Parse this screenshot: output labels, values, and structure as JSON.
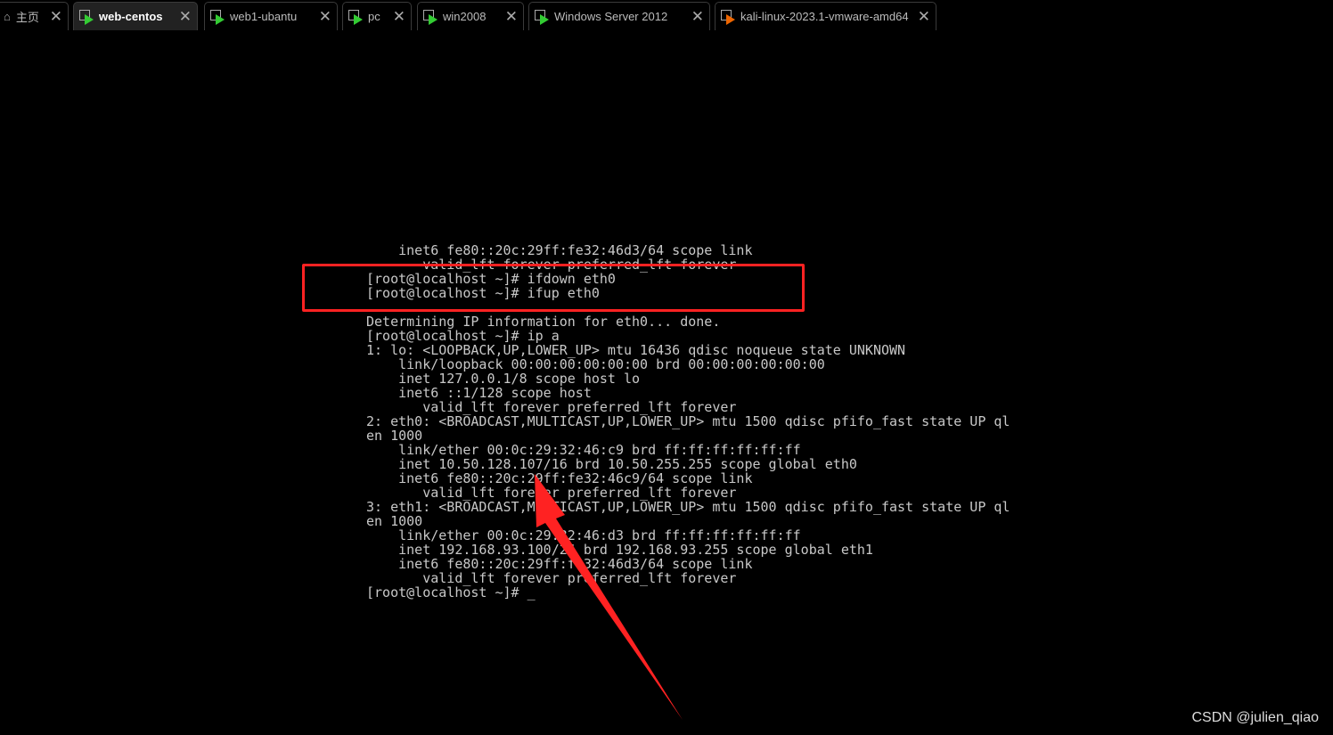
{
  "tabs": [
    {
      "label": "主页",
      "icon": "home-icon",
      "active": false
    },
    {
      "label": "web-centos",
      "icon": "vm-icon",
      "active": true
    },
    {
      "label": "web1-ubantu",
      "icon": "vm-icon",
      "active": false
    },
    {
      "label": "pc",
      "icon": "vm-icon",
      "active": false
    },
    {
      "label": "win2008",
      "icon": "vm-icon",
      "active": false
    },
    {
      "label": "Windows Server 2012",
      "icon": "vm-icon",
      "active": false
    },
    {
      "label": "kali-linux-2023.1-vmware-amd64",
      "icon": "vm-icon",
      "active": false
    }
  ],
  "terminal": {
    "lines": [
      "    inet6 fe80::20c:29ff:fe32:46d3/64 scope link",
      "       valid_lft forever preferred_lft forever",
      "[root@localhost ~]# ifdown eth0",
      "[root@localhost ~]# ifup eth0",
      "",
      "Determining IP information for eth0... done.",
      "[root@localhost ~]# ip a",
      "1: lo: <LOOPBACK,UP,LOWER_UP> mtu 16436 qdisc noqueue state UNKNOWN",
      "    link/loopback 00:00:00:00:00:00 brd 00:00:00:00:00:00",
      "    inet 127.0.0.1/8 scope host lo",
      "    inet6 ::1/128 scope host",
      "       valid_lft forever preferred_lft forever",
      "2: eth0: <BROADCAST,MULTICAST,UP,LOWER_UP> mtu 1500 qdisc pfifo_fast state UP ql",
      "en 1000",
      "    link/ether 00:0c:29:32:46:c9 brd ff:ff:ff:ff:ff:ff",
      "    inet 10.50.128.107/16 brd 10.50.255.255 scope global eth0",
      "    inet6 fe80::20c:29ff:fe32:46c9/64 scope link",
      "       valid_lft forever preferred_lft forever",
      "3: eth1: <BROADCAST,MULTICAST,UP,LOWER_UP> mtu 1500 qdisc pfifo_fast state UP ql",
      "en 1000",
      "    link/ether 00:0c:29:32:46:d3 brd ff:ff:ff:ff:ff:ff",
      "    inet 192.168.93.100/24 brd 192.168.93.255 scope global eth1",
      "    inet6 fe80::20c:29ff:fe32:46d3/64 scope link",
      "       valid_lft forever preferred_lft forever",
      "[root@localhost ~]# _"
    ]
  },
  "annotation_color": "#ff2222",
  "watermark": "CSDN @julien_qiao"
}
